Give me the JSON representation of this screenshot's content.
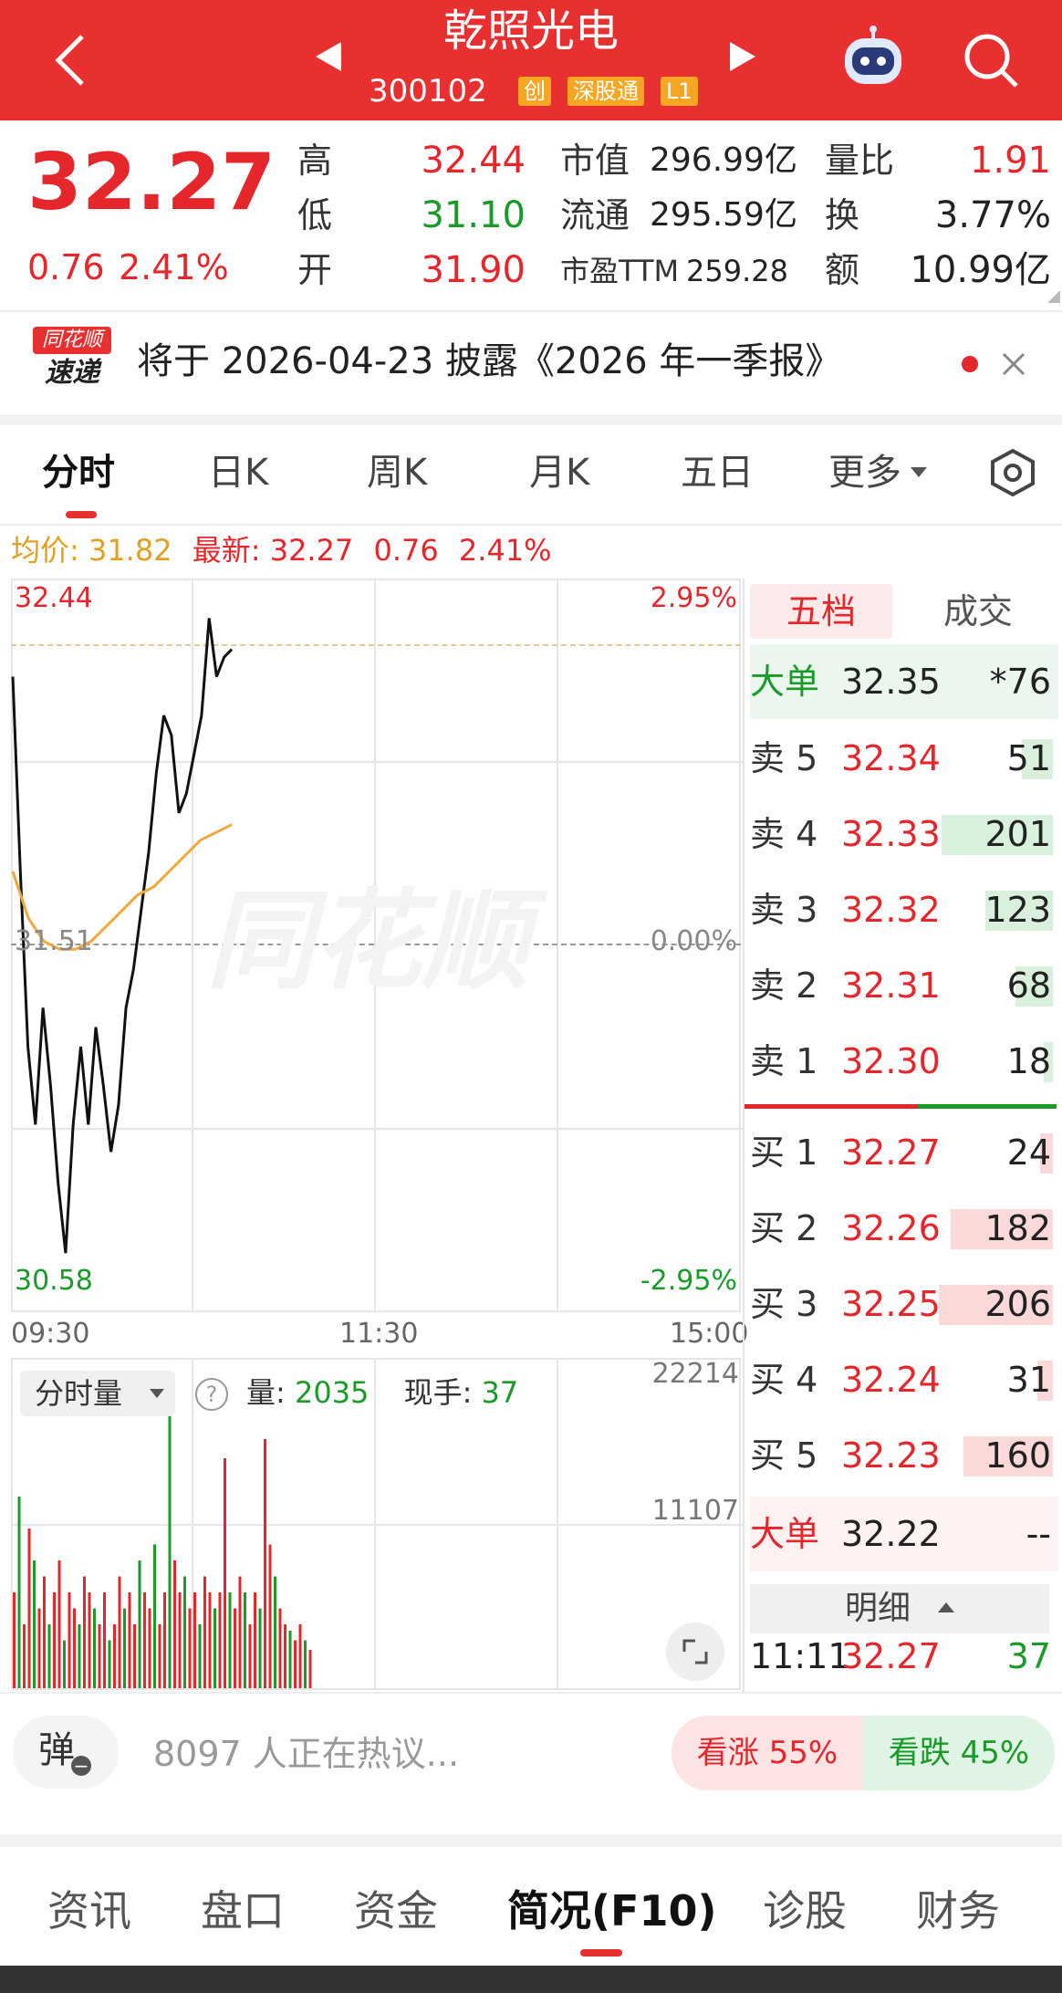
{
  "header": {
    "title": "乾照光电",
    "code": "300102",
    "tags": [
      "创",
      "深股通",
      "L1"
    ]
  },
  "quote": {
    "price": "32.27",
    "change": "0.76",
    "change_pct": "2.41%",
    "high_label": "高",
    "high": "32.44",
    "low_label": "低",
    "low": "31.10",
    "open_label": "开",
    "open": "31.90",
    "mcap_label": "市值",
    "mcap": "296.99亿",
    "float_label": "流通",
    "float": "295.59亿",
    "pe_label": "市盈TTM",
    "pe": "259.28",
    "vol_ratio_label": "量比",
    "vol_ratio": "1.91",
    "turnover_label": "换",
    "turnover": "3.77%",
    "amount_label": "额",
    "amount": "10.99亿"
  },
  "news": {
    "logo_top": "同花顺",
    "logo_bottom": "速递",
    "text": "将于 2026-04-23 披露《2026 年一季报》"
  },
  "tabs": [
    "分时",
    "日K",
    "周K",
    "月K",
    "五日",
    "更多"
  ],
  "chart_info": {
    "avg_label": "均价: 31.82",
    "latest_label": "最新: 32.27",
    "change": "0.76",
    "change_pct": "2.41%"
  },
  "chart_data": {
    "type": "line",
    "title": "",
    "x_ticks": [
      "09:30",
      "11:30",
      "15:00"
    ],
    "y_ticks": [
      "32.44",
      "31.51",
      "30.58"
    ],
    "pct_ticks": [
      "2.95%",
      "0.00%",
      "-2.95%"
    ],
    "ylim": [
      30.58,
      32.44
    ],
    "watermark": "同花顺",
    "series": [
      {
        "type": "line",
        "color": "#111111",
        "values": [
          32.2,
          31.7,
          31.25,
          31.05,
          31.35,
          31.15,
          30.9,
          30.72,
          31.05,
          31.25,
          31.05,
          31.3,
          31.15,
          30.98,
          31.1,
          31.35,
          31.45,
          31.6,
          31.75,
          31.95,
          32.1,
          32.05,
          31.85,
          31.9,
          32.0,
          32.1,
          32.35,
          32.2,
          32.25,
          32.27
        ]
      },
      {
        "type": "line",
        "color": "#f0a83c",
        "values": [
          31.7,
          31.58,
          31.52,
          31.5,
          31.5,
          31.52,
          31.56,
          31.6,
          31.64,
          31.66,
          31.7,
          31.74,
          31.78,
          31.8,
          31.82
        ]
      }
    ],
    "volume": {
      "label": "分时量",
      "vol_label": "量:",
      "vol": "2035",
      "hand_label": "现手:",
      "hand": "37",
      "ticks": [
        "22214",
        "11107"
      ]
    }
  },
  "orderbook": {
    "tab_active": "五档",
    "tab_other": "成交",
    "big_top": {
      "label": "大单",
      "price": "32.35",
      "vol": "*76"
    },
    "sells": [
      {
        "label": "卖 5",
        "price": "32.34",
        "vol": "51",
        "frac": 0.1
      },
      {
        "label": "卖 4",
        "price": "32.33",
        "vol": "201",
        "frac": 0.36
      },
      {
        "label": "卖 3",
        "price": "32.32",
        "vol": "123",
        "frac": 0.22
      },
      {
        "label": "卖 2",
        "price": "32.31",
        "vol": "68",
        "frac": 0.12
      },
      {
        "label": "卖 1",
        "price": "32.30",
        "vol": "18",
        "frac": 0.03
      }
    ],
    "buys": [
      {
        "label": "买 1",
        "price": "32.27",
        "vol": "24",
        "frac": 0.04
      },
      {
        "label": "买 2",
        "price": "32.26",
        "vol": "182",
        "frac": 0.33
      },
      {
        "label": "买 3",
        "price": "32.25",
        "vol": "206",
        "frac": 0.37
      },
      {
        "label": "买 4",
        "price": "32.24",
        "vol": "31",
        "frac": 0.05
      },
      {
        "label": "买 5",
        "price": "32.23",
        "vol": "160",
        "frac": 0.29
      }
    ],
    "big_bottom": {
      "label": "大单",
      "price": "32.22",
      "vol": "--"
    },
    "detail_label": "明细",
    "tick": {
      "time": "11:11",
      "price": "32.27",
      "vol": "37"
    }
  },
  "discuss": {
    "barrage": "弹",
    "text": "8097 人正在热议...",
    "bull": "看涨 55%",
    "bear": "看跌 45%"
  },
  "bottom_tabs": [
    "资讯",
    "盘口",
    "资金",
    "简况(F10)",
    "诊股",
    "财务"
  ],
  "colors": {
    "brand": "#e93030",
    "up": "#e5262b",
    "down": "#1a9a27",
    "avg": "#f0a83c"
  }
}
